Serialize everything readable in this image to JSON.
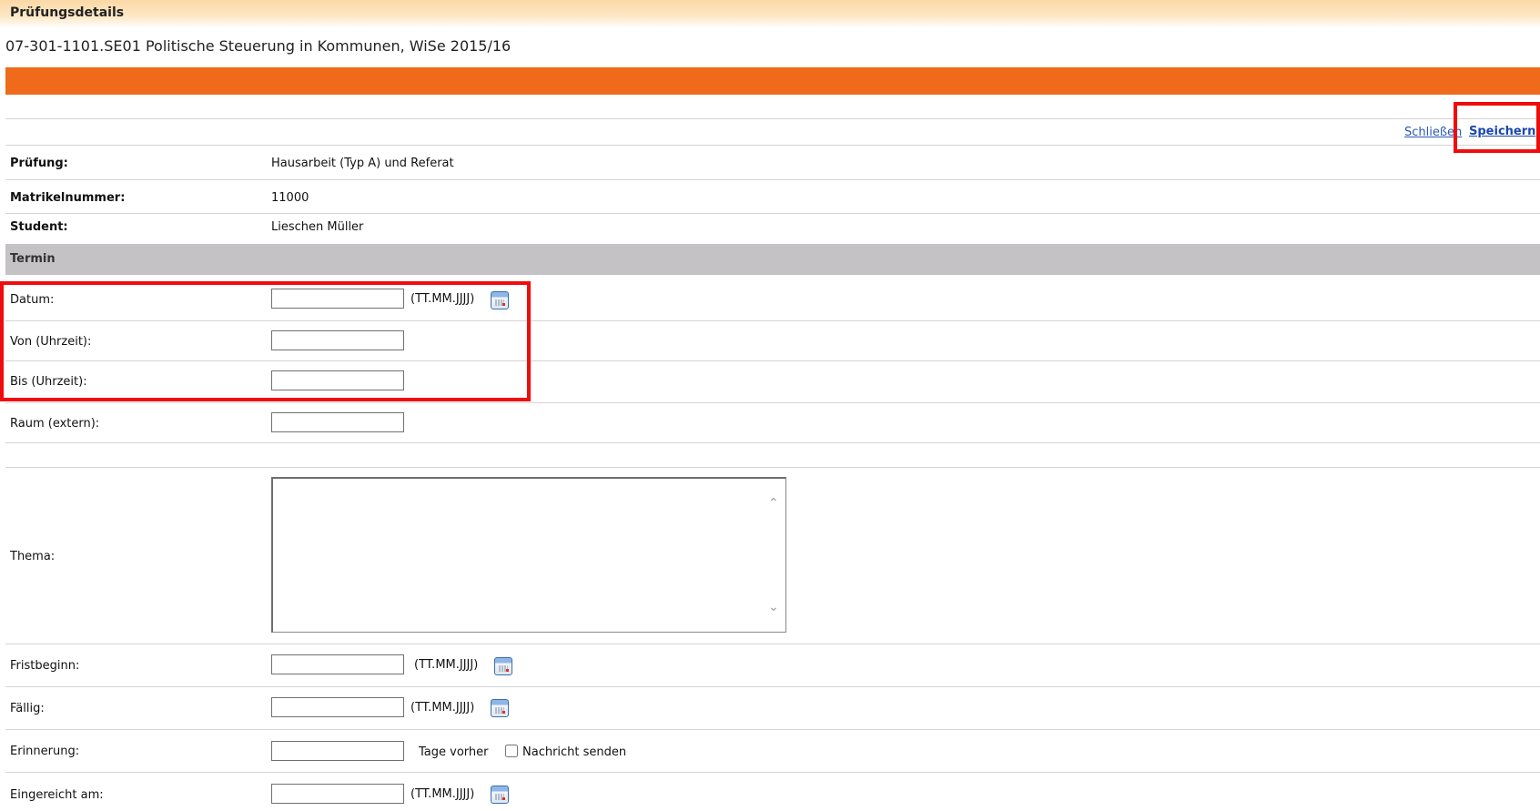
{
  "header": {
    "title": "Prüfungsdetails"
  },
  "course": {
    "subtitle": "07-301-1101.SE01 Politische Steuerung in Kommunen, WiSe 2015/16"
  },
  "actions": {
    "close_label": "Schließen",
    "save_label": "Speichern"
  },
  "info": {
    "exam_label": "Prüfung:",
    "exam_value": "Hausarbeit (Typ A) und Referat",
    "matrikel_label": "Matrikelnummer:",
    "matrikel_value": "11000",
    "student_label": "Student:",
    "student_value": "Lieschen Müller"
  },
  "section": {
    "termin": "Termin"
  },
  "form": {
    "date_format_hint": "(TT.MM.JJJJ)",
    "datum_label": "Datum:",
    "von_label": "Von (Uhrzeit):",
    "bis_label": "Bis (Uhrzeit):",
    "raum_label": "Raum (extern):",
    "thema_label": "Thema:",
    "fristbeginn_label": "Fristbeginn:",
    "faellig_label": "Fällig:",
    "erinnerung_label": "Erinnerung:",
    "tage_vorher": "Tage vorher",
    "nachricht_senden": "Nachricht senden",
    "eingereicht_label": "Eingereicht am:",
    "values": {
      "datum": "",
      "von": "",
      "bis": "",
      "raum": "",
      "thema": "",
      "fristbeginn": "",
      "faellig": "",
      "erinnerung": "",
      "eingereicht": ""
    },
    "nachricht_checked": false
  },
  "icons": {
    "calendar": "calendar-icon"
  },
  "colors": {
    "accent_orange": "#ef6a1b",
    "section_gray": "#c4c2c4",
    "highlight_red": "#f00c0c",
    "link_blue": "#1a47b0"
  }
}
